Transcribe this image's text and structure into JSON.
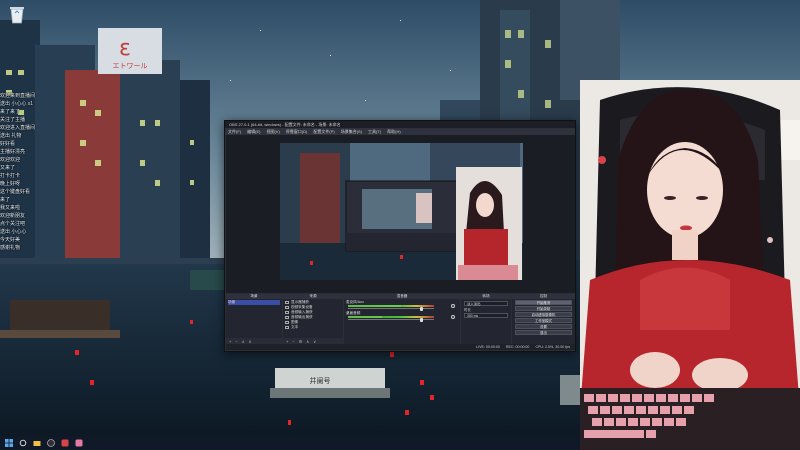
{
  "desktop": {
    "recycle_bin_icon": "recycle-bin-icon"
  },
  "wallpaper": {
    "sign_text": "エトワール",
    "boat_text": "井阑号"
  },
  "chat": {
    "lines": [
      {
        "text": "欢迎来到直播间"
      },
      {
        "text": "送出 小心心 x1"
      },
      {
        "text": "来了来了"
      },
      {
        "text": "关注了主播"
      },
      {
        "text": "欢迎进入直播间"
      },
      {
        "text": "送出 礼物"
      },
      {
        "text": "好好看"
      },
      {
        "text": "主播好漂亮"
      },
      {
        "text": "欢迎欢迎"
      },
      {
        "text": "又来了"
      },
      {
        "text": "打卡打卡"
      },
      {
        "text": "晚上好呀"
      },
      {
        "text": "这个键盘好看"
      },
      {
        "text": "来了"
      },
      {
        "text": "我又来啦"
      },
      {
        "text": "欢迎新朋友"
      },
      {
        "text": "点个关注吧"
      },
      {
        "text": "送出 小心心"
      },
      {
        "text": "今天好美"
      },
      {
        "text": "感谢礼物"
      }
    ]
  },
  "obs": {
    "title": "OBS 27.0.1 (64-bit, windows) - 配置文件: 未命名 - 场景: 未命名",
    "controls": [
      "开始推流",
      "开始录制",
      "启动虚拟摄像机",
      "工作室模式",
      "设置",
      "退出"
    ],
    "menu": [
      "文件(F)",
      "编辑(E)",
      "视图(V)",
      "停靠窗口(D)",
      "配置文件(P)",
      "场景集合(S)",
      "工具(T)",
      "帮助(H)"
    ],
    "docks": {
      "scenes_title": "场景",
      "sources_title": "来源",
      "mixer_title": "混音器",
      "transitions_title": "转场",
      "controls_title": "控制"
    },
    "scenes": [
      "场景"
    ],
    "sources": [
      "显示器捕获",
      "视频采集设备",
      "音频输入捕获",
      "音频输出捕获",
      "图像",
      "文本"
    ],
    "mixer": [
      {
        "name": "麦克风/Aux",
        "level": 0.62,
        "volume": 0.85
      },
      {
        "name": "桌面音频",
        "level": 0.4,
        "volume": 0.85
      }
    ],
    "transitions": {
      "type": "淡入淡出",
      "duration_label": "时长",
      "duration": "300 ms"
    },
    "footer_add": "+",
    "footer_remove": "−",
    "footer_settings": "⚙",
    "footer_up": "∧",
    "footer_down": "∨",
    "status": [
      "LIVE: 00:00:00",
      "REC: 00:00:00",
      "CPU: 2.5%, 30.00 fps"
    ]
  },
  "colors": {
    "sky_top": "#3c5a73",
    "sky_bottom": "#8aa0ae",
    "water": "#0f2130",
    "lantern": "#e3242b",
    "obs_bg": "#2b2e38"
  }
}
